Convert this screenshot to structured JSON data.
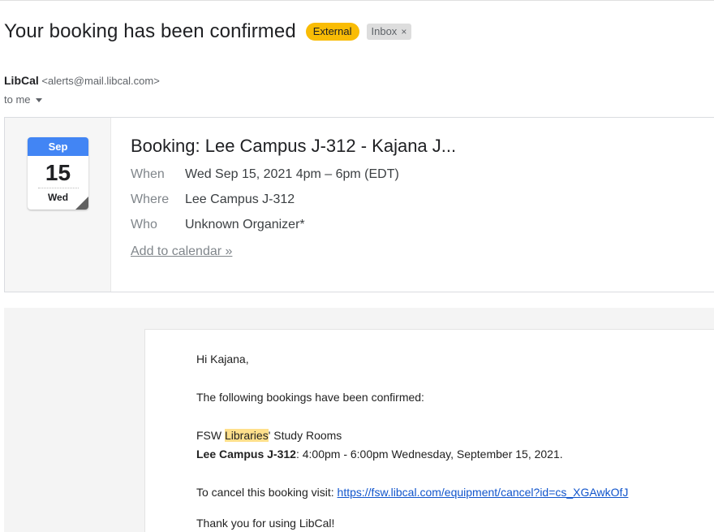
{
  "email": {
    "subject": "Your booking has been confirmed",
    "labels": {
      "external": "External",
      "inbox": "Inbox",
      "remove_symbol": "×"
    },
    "sender": {
      "name": "LibCal",
      "email": "<alerts@mail.libcal.com>"
    },
    "recipient": "to me"
  },
  "invite": {
    "calendar_icon": {
      "month": "Sep",
      "day": "15",
      "weekday": "Wed"
    },
    "title": "Booking: Lee Campus J-312 - Kajana J...",
    "details": [
      {
        "key": "When",
        "value": "Wed Sep 15, 2021 4pm – 6pm (EDT)"
      },
      {
        "key": "Where",
        "value": "Lee Campus J-312"
      },
      {
        "key": "Who",
        "value": "Unknown Organizer*"
      }
    ],
    "add_to_calendar": "Add to calendar »"
  },
  "body": {
    "greeting": "Hi Kajana,",
    "intro": "The following bookings have been confirmed:",
    "org_prefix": "FSW ",
    "org_highlight": "Libraries",
    "org_suffix": "' Study Rooms",
    "room": "Lee Campus J-312",
    "booking_time": ": 4:00pm - 6:00pm Wednesday, September 15, 2021.",
    "cancel_prefix": "To cancel this booking visit: ",
    "cancel_url": "https://fsw.libcal.com/equipment/cancel?id=cs_XGAwkOfJ",
    "closing": "Thank you for using LibCal!"
  },
  "colors": {
    "external_badge": "#f9bc05",
    "calendar_header": "#4285f4",
    "link": "#1155cc",
    "highlight": "#ffe08c"
  }
}
